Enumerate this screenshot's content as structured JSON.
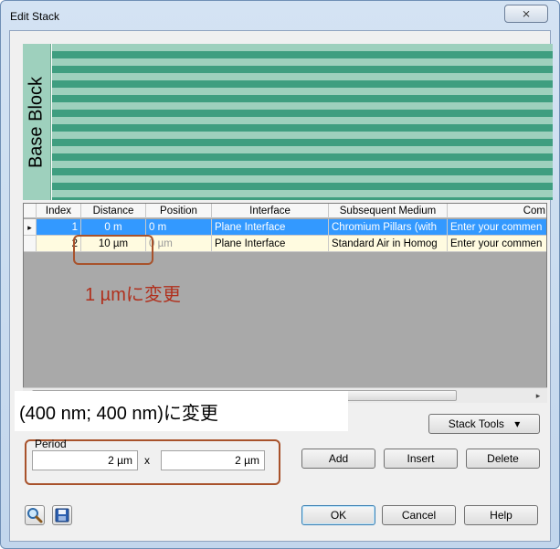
{
  "window": {
    "title": "Edit Stack",
    "close_glyph": "⨯"
  },
  "base_block": {
    "label": "Base Block"
  },
  "grid": {
    "columns": [
      "Index",
      "Distance",
      "Position",
      "Interface",
      "Subsequent Medium",
      "Com"
    ],
    "rows": [
      {
        "marker": "▸",
        "index": "1",
        "distance": "0 m",
        "position": "0 m",
        "interface": "Plane Interface",
        "medium": "Chromium Pillars (with",
        "comment": "Enter your commen"
      },
      {
        "marker": "",
        "index": "2",
        "distance": "10 µm",
        "position": "0 µm",
        "interface": "Plane Interface",
        "medium": "Standard Air in Homog",
        "comment": "Enter your commen"
      }
    ]
  },
  "annotations": {
    "distance_note": "1 µmに変更",
    "period_note": "(400 nm; 400 nm)に変更"
  },
  "stack_tools": {
    "label": "Stack Tools",
    "arrow": "▾"
  },
  "period": {
    "label": "Period",
    "x_value": "2 µm",
    "y_value": "2 µm",
    "times": "x"
  },
  "buttons": {
    "add": "Add",
    "insert": "Insert",
    "delete": "Delete",
    "ok": "OK",
    "cancel": "Cancel",
    "help": "Help"
  },
  "scroll": {
    "right_arrow": "▸"
  },
  "colors": {
    "stripe_light": "#9ed0bd",
    "stripe_dark": "#3f9e80",
    "selection": "#3399ff",
    "annotation": "#a8522b"
  }
}
